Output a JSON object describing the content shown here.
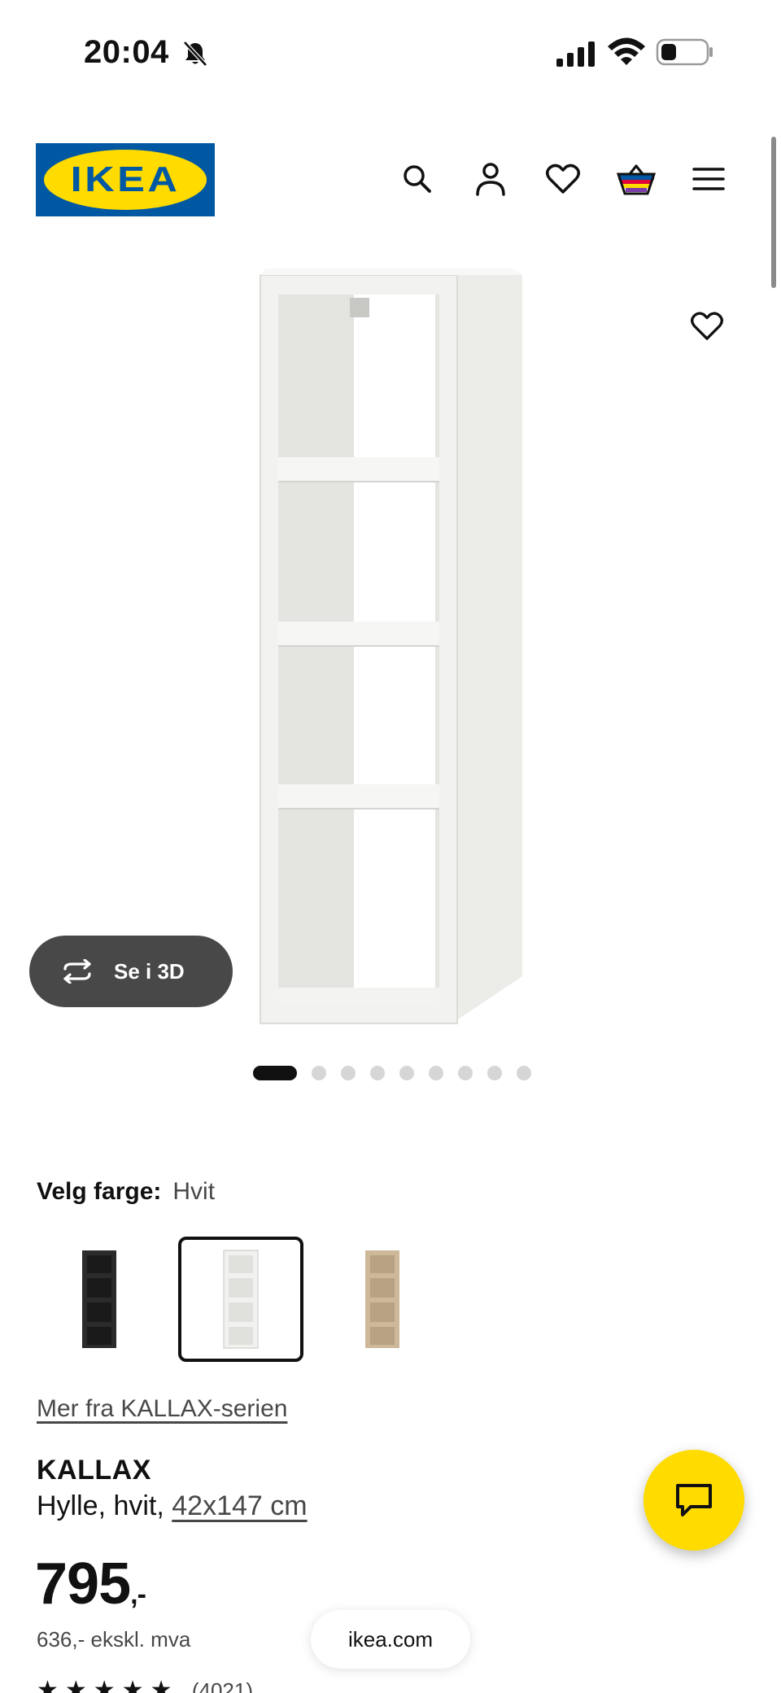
{
  "status_bar": {
    "time": "20:04",
    "icons": [
      "bell-slash-icon",
      "signal-icon",
      "wifi-icon",
      "battery-icon"
    ]
  },
  "header": {
    "logo_text": "IKEA",
    "icons": [
      "search-icon",
      "account-icon",
      "heart-icon",
      "cart-icon",
      "menu-icon"
    ],
    "colors": {
      "logo_blue": "#0058a3",
      "logo_yellow": "#ffdb00"
    }
  },
  "media": {
    "view_3d_label": "Se i 3D",
    "image_count": 9,
    "active_image": 1
  },
  "color_selector": {
    "label": "Velg farge:",
    "selected": "Hvit",
    "options": [
      "black",
      "white",
      "oak"
    ]
  },
  "series_link": "Mer fra KALLAX-serien",
  "product": {
    "name": "KALLAX",
    "description_prefix": "Hylle, hvit, ",
    "size": "42x147 cm",
    "price": "795",
    "price_suffix": ",-",
    "price_ex_vat": "636,- ekskl. mva",
    "rating_stars": "★★★★★",
    "rating_count": "(4021)"
  },
  "browser": {
    "url": "ikea.com"
  },
  "colors": {
    "chat_fab": "#ffdb00",
    "dark_button": "#484848"
  }
}
